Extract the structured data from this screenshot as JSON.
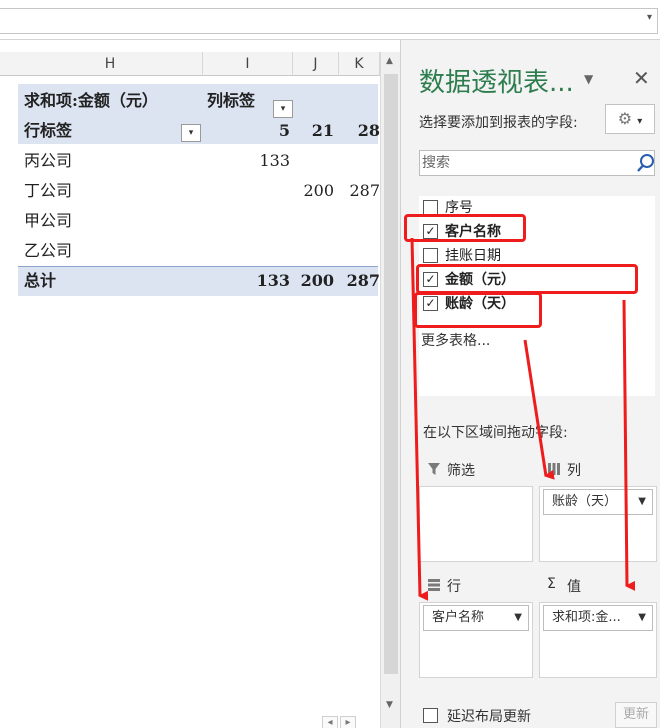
{
  "columns": [
    {
      "name": "H"
    },
    {
      "name": "I"
    },
    {
      "name": "J"
    },
    {
      "name": "K"
    }
  ],
  "pivot": {
    "value_header": "求和项:金额（元）",
    "col_label_header": "列标签",
    "row_label_header": "行标签",
    "col_values": [
      "5",
      "21",
      "28"
    ],
    "rows": [
      {
        "label": "丙公司",
        "i": "133",
        "j": "",
        "k": ""
      },
      {
        "label": "丁公司",
        "i": "",
        "j": "200",
        "k": "287"
      },
      {
        "label": "甲公司",
        "i": "",
        "j": "",
        "k": ""
      },
      {
        "label": "乙公司",
        "i": "",
        "j": "",
        "k": ""
      }
    ],
    "total": {
      "label": "总计",
      "i": "133",
      "j": "200",
      "k": "287"
    }
  },
  "panel": {
    "title": "数据透视表...",
    "subtitle": "选择要添加到报表的字段:",
    "search_placeholder": "搜索",
    "fields": [
      {
        "label": "序号",
        "checked": false
      },
      {
        "label": "客户名称",
        "checked": true
      },
      {
        "label": "挂账日期",
        "checked": false
      },
      {
        "label": "金额（元）",
        "checked": true
      },
      {
        "label": "账龄（天）",
        "checked": true
      }
    ],
    "more_tables": "更多表格...",
    "drag_label": "在以下区域间拖动字段:",
    "areas": {
      "filter": {
        "title": "筛选"
      },
      "columns": {
        "title": "列",
        "chip": "账龄（天）"
      },
      "rows": {
        "title": "行",
        "chip": "客户名称"
      },
      "values": {
        "title": "值",
        "chip": "求和项:金..."
      }
    },
    "defer_label": "延迟布局更新",
    "update_label": "更新"
  },
  "colors": {
    "accent": "#2e7d4f",
    "band": "#dce4f2",
    "annotation": "#ee1c1c"
  }
}
